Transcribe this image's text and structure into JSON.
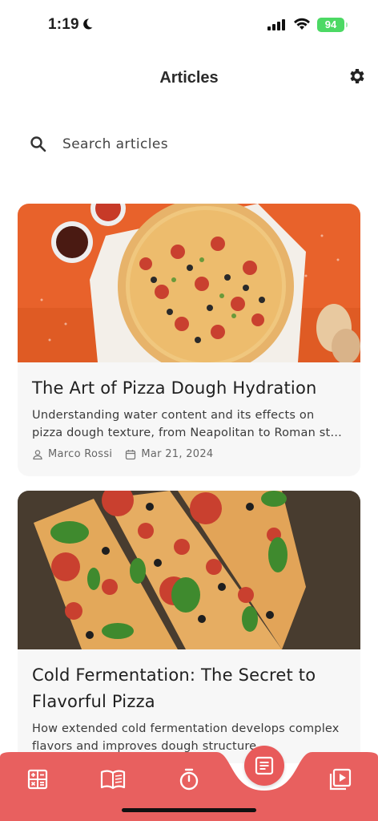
{
  "status": {
    "time": "1:19",
    "battery": "94"
  },
  "header": {
    "title": "Articles"
  },
  "search": {
    "placeholder": "Search articles"
  },
  "articles": [
    {
      "title": "The Art of Pizza Dough Hydration",
      "excerpt": "Understanding water content and its effects on pizza dough texture, from Neapolitan to Roman st…",
      "author": "Marco Rossi",
      "date": "Mar 21, 2024"
    },
    {
      "title": "Cold Fermentation: The Secret to Flavorful Pizza",
      "excerpt": "How extended cold fermentation develops complex flavors and improves dough structure"
    }
  ],
  "nav": {
    "items": [
      "calculator-icon",
      "book-icon",
      "timer-icon",
      "articles-icon",
      "video-icon"
    ],
    "active": "articles-icon"
  },
  "colors": {
    "accent": "#e85a5a",
    "card_bg": "#f7f7f7",
    "battery": "#4cd964"
  }
}
